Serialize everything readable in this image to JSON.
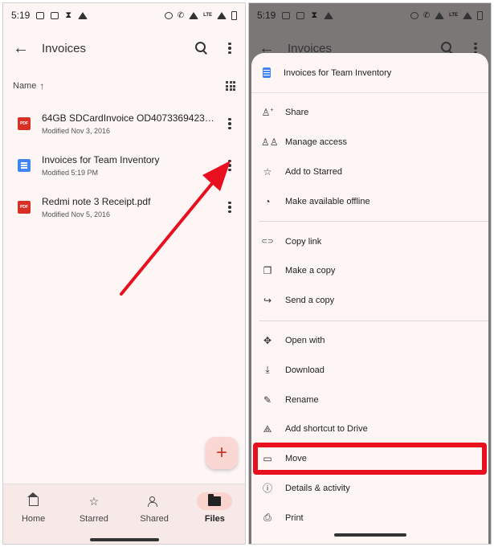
{
  "statusbar": {
    "time": "5:19",
    "lte": "LTE"
  },
  "left": {
    "appbar": {
      "title": "Invoices"
    },
    "sort": {
      "label": "Name",
      "arrow": "↑"
    },
    "files": [
      {
        "name": "64GB SDCardInvoice OD40733694235...",
        "modified": "Modified Nov 3, 2016",
        "type": "pdf",
        "icon": "PDF"
      },
      {
        "name": "Invoices for Team Inventory",
        "modified": "Modified 5:19 PM",
        "type": "doc",
        "icon": ""
      },
      {
        "name": "Redmi note 3 Receipt.pdf",
        "modified": "Modified Nov 5, 2016",
        "type": "pdf",
        "icon": "PDF"
      }
    ],
    "fab": "+",
    "nav": [
      {
        "label": "Home",
        "icon": "home-icon"
      },
      {
        "label": "Starred",
        "icon": "star-icon"
      },
      {
        "label": "Shared",
        "icon": "people-icon"
      },
      {
        "label": "Files",
        "icon": "folder-icon",
        "active": true
      }
    ],
    "annotation_color": "#e8101f"
  },
  "right": {
    "appbar": {
      "title": "Invoices"
    },
    "sheet": {
      "title": "Invoices for Team Inventory",
      "groups": [
        [
          {
            "label": "Share",
            "icon": "person-add-icon",
            "glyph": "⁺"
          },
          {
            "label": "Manage access",
            "icon": "people-icon",
            "glyph": ""
          },
          {
            "label": "Add to Starred",
            "icon": "star-icon",
            "glyph": "☆"
          },
          {
            "label": "Make available offline",
            "icon": "offline-icon",
            "glyph": "◔"
          }
        ],
        [
          {
            "label": "Copy link",
            "icon": "link-icon",
            "glyph": "⊂⊃"
          },
          {
            "label": "Make a copy",
            "icon": "copy-icon",
            "glyph": "❐"
          },
          {
            "label": "Send a copy",
            "icon": "send-icon",
            "glyph": "↪"
          }
        ],
        [
          {
            "label": "Open with",
            "icon": "open-with-icon",
            "glyph": "✥"
          },
          {
            "label": "Download",
            "icon": "download-icon",
            "glyph": "⤓"
          },
          {
            "label": "Rename",
            "icon": "edit-icon",
            "glyph": "✎"
          },
          {
            "label": "Add shortcut to Drive",
            "icon": "add-shortcut-icon",
            "glyph": "⟁"
          },
          {
            "label": "Move",
            "icon": "move-icon",
            "glyph": "▭",
            "highlighted": true
          },
          {
            "label": "Details & activity",
            "icon": "info-icon",
            "glyph": "ⓘ"
          },
          {
            "label": "Print",
            "icon": "print-icon",
            "glyph": "⎙"
          }
        ]
      ]
    },
    "highlight_color": "#e8101f"
  }
}
